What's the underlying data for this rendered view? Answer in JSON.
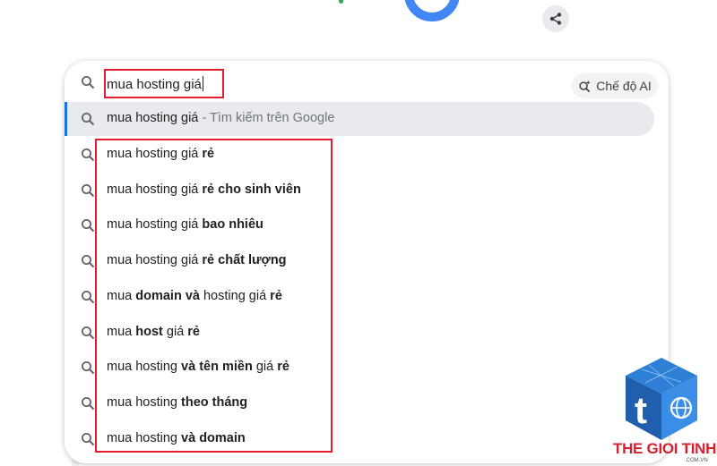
{
  "search": {
    "query": "mua hosting giá",
    "ai_mode_label": "Chế độ AI"
  },
  "highlighted": {
    "query": "mua hosting giá",
    "suffix": " - Tìm kiếm trên Google"
  },
  "suggestions": [
    {
      "parts": [
        {
          "t": "mua hosting giá ",
          "b": false
        },
        {
          "t": "rẻ",
          "b": true
        }
      ]
    },
    {
      "parts": [
        {
          "t": "mua hosting giá ",
          "b": false
        },
        {
          "t": "rẻ cho sinh viên",
          "b": true
        }
      ]
    },
    {
      "parts": [
        {
          "t": "mua hosting giá ",
          "b": false
        },
        {
          "t": "bao nhiêu",
          "b": true
        }
      ]
    },
    {
      "parts": [
        {
          "t": "mua hosting giá ",
          "b": false
        },
        {
          "t": "rẻ chất lượng",
          "b": true
        }
      ]
    },
    {
      "parts": [
        {
          "t": "mua ",
          "b": false
        },
        {
          "t": "domain và",
          "b": true
        },
        {
          "t": " hosting giá ",
          "b": false
        },
        {
          "t": "rẻ",
          "b": true
        }
      ]
    },
    {
      "parts": [
        {
          "t": "mua ",
          "b": false
        },
        {
          "t": "host",
          "b": true
        },
        {
          "t": " giá ",
          "b": false
        },
        {
          "t": "rẻ",
          "b": true
        }
      ]
    },
    {
      "parts": [
        {
          "t": "mua hosting ",
          "b": false
        },
        {
          "t": "và tên miền",
          "b": true
        },
        {
          "t": " giá ",
          "b": false
        },
        {
          "t": "rẻ",
          "b": true
        }
      ]
    },
    {
      "parts": [
        {
          "t": "mua hosting ",
          "b": false
        },
        {
          "t": "theo tháng",
          "b": true
        }
      ]
    },
    {
      "parts": [
        {
          "t": "mua hosting ",
          "b": false
        },
        {
          "t": "và domain",
          "b": true
        }
      ]
    }
  ],
  "watermark": {
    "brand": "THE GIOI TINHOC",
    "domain": ".COM.VN",
    "letter": "t"
  },
  "colors": {
    "accent": "#1a73e8",
    "annotation_red": "#e21d2f",
    "watermark_blue": "#1f5fae"
  }
}
